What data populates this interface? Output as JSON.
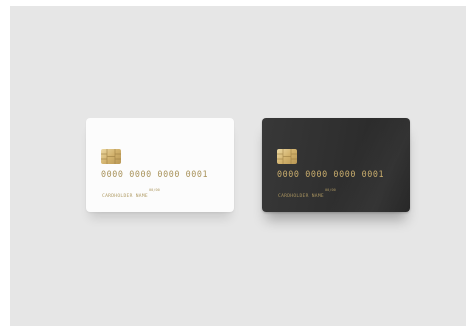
{
  "cards": [
    {
      "style": "white",
      "number": "0000 0000 0000 0001",
      "expiry": "00/00",
      "holder": "CARDHOLDER NAME"
    },
    {
      "style": "black",
      "number": "0000 0000 0000 0001",
      "expiry": "00/00",
      "holder": "CARDHOLDER NAME"
    }
  ],
  "colors": {
    "background": "#e6e6e6",
    "white_card": "#fcfcfc",
    "black_card": "#303030",
    "gold": "#c9ad6d"
  }
}
